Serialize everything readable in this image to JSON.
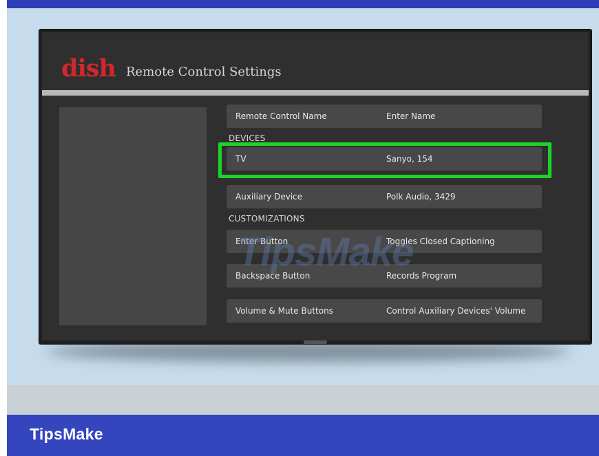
{
  "brand": {
    "logo": "dish",
    "app_title": "Remote Control Settings"
  },
  "settings": {
    "rows": [
      {
        "label": "Remote Control Name",
        "value": "Enter Name"
      },
      {
        "label": "TV",
        "value": "Sanyo, 154"
      },
      {
        "label": "Auxiliary Device",
        "value": "Polk Audio, 3429"
      },
      {
        "label": "Enter Button",
        "value": "Toggles Closed Captioning"
      },
      {
        "label": "Backspace Button",
        "value": "Records Program"
      },
      {
        "label": "Volume & Mute Buttons",
        "value": "Control Auxiliary Devices' Volume"
      }
    ],
    "sections": {
      "devices": "DEVICES",
      "customizations": "CUSTOMIZATIONS"
    }
  },
  "watermark": "TipsMake",
  "footer": {
    "label": "TipsMake"
  },
  "colors": {
    "highlight": "#1dd228",
    "footer_bar": "#3545be",
    "logo_red": "#d3262d",
    "backdrop": "#c6dced"
  }
}
